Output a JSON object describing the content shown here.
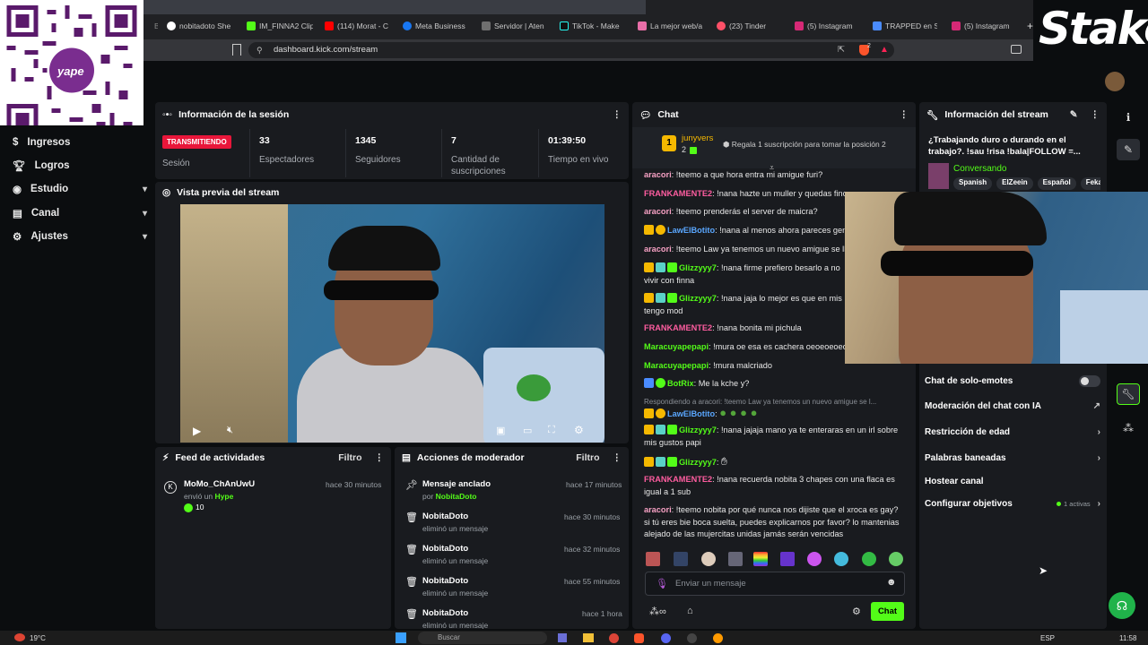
{
  "browser": {
    "tabs": [
      {
        "label": "nobitadoto She"
      },
      {
        "label": "IM_FINNA2 Clip"
      },
      {
        "label": "(114) Morat - C"
      },
      {
        "label": "Meta Business"
      },
      {
        "label": "Servidor | Aten"
      },
      {
        "label": "TikTok - Make"
      },
      {
        "label": "La mejor web/a"
      },
      {
        "label": "(23) Tinder"
      },
      {
        "label": "(5) Instagram"
      },
      {
        "label": "TRAPPED en St"
      },
      {
        "label": "(5) Instagram"
      }
    ],
    "url": "dashboard.kick.com/stream",
    "brave_count": "2"
  },
  "overlay": {
    "qr_brand": "yape",
    "stake_logo": "Stake"
  },
  "sidebar": {
    "items": [
      {
        "label": "Ingresos"
      },
      {
        "label": "Logros"
      },
      {
        "label": "Estudio",
        "chevron": "▾"
      },
      {
        "label": "Canal",
        "chevron": "▾"
      },
      {
        "label": "Ajustes",
        "chevron": "▾"
      }
    ]
  },
  "session": {
    "title": "Información de la sesión",
    "status": "TRANSMITIENDO",
    "session_label": "Sesión",
    "stats": [
      {
        "value": "33",
        "label": "Espectadores"
      },
      {
        "value": "1345",
        "label": "Seguidores"
      },
      {
        "value": "7",
        "label": "Cantidad de suscripciones"
      },
      {
        "value": "01:39:50",
        "label": "Tiempo en vivo"
      }
    ]
  },
  "preview": {
    "title": "Vista previa del stream"
  },
  "feed": {
    "title": "Feed de actividades",
    "filter": "Filtro",
    "items": [
      {
        "user": "MoMo_ChAnUwU",
        "action": "envió un",
        "item": "Hype",
        "time": "hace 30 minutos",
        "amount": "10"
      }
    ]
  },
  "modactions": {
    "title": "Acciones de moderador",
    "filter": "Filtro",
    "items": [
      {
        "title": "Mensaje anclado",
        "by": "por",
        "user": "NobitaDoto",
        "time": "hace 17 minutos"
      },
      {
        "title": "NobitaDoto",
        "sub": "eliminó un mensaje",
        "time": "hace 30 minutos"
      },
      {
        "title": "NobitaDoto",
        "sub": "eliminó un mensaje",
        "time": "hace 32 minutos"
      },
      {
        "title": "NobitaDoto",
        "sub": "eliminó un mensaje",
        "time": "hace 55 minutos"
      },
      {
        "title": "NobitaDoto",
        "sub": "eliminó un mensaje",
        "time": "hace 1 hora"
      }
    ]
  },
  "chat": {
    "title": "Chat",
    "top_user": "junyvers",
    "top_count": "2",
    "top_rank": "1",
    "gift_prompt": "Regala 1 suscripción para tomar la posición 2",
    "messages": [
      {
        "user": "aracori",
        "color": "#f7a1c4",
        "text": ": !teemo a que hora entra mi amigue furi?"
      },
      {
        "user": "FRANKAMENTE2",
        "color": "#ff5da0",
        "text": ": !nana hazte un muller y quedas fino"
      },
      {
        "user": "aracori",
        "color": "#f7a1c4",
        "text": ": !teemo prenderás el server de maicra?"
      },
      {
        "user": "LawElBotito",
        "color": "#5aa7ff",
        "text": ": !nana al menos ahora pareces gente"
      },
      {
        "user": "aracori",
        "color": "#f7a1c4",
        "text": ": !teemo Law ya tenemos un nuevo amigue se lla"
      },
      {
        "user": "Glizzyyy7",
        "color": "#53fc18",
        "text": ": !nana firme prefiero besarlo a no",
        "text2": "vivir con finna"
      },
      {
        "user": "Glizzyyy7",
        "color": "#53fc18",
        "text": ": !nana jaja lo mejor es que en mis",
        "text2": "tengo mod"
      },
      {
        "user": "FRANKAMENTE2",
        "color": "#ff5da0",
        "text": ": !nana bonita mi pichula"
      },
      {
        "user": "Maracuyapepapi",
        "color": "#53fc18",
        "text": ": !mura oe esa es cachera oeoeoeoeo"
      },
      {
        "user": "Maracuyapepapi",
        "color": "#53fc18",
        "text": ": !mura malcriado"
      },
      {
        "user": "BotRix",
        "color": "#53fc18",
        "text": ": Me la kche y?"
      },
      {
        "reply": "Respondiendo a aracori: !teemo Law ya tenemos un nuevo amigue se l...",
        "user": "LawElBotito",
        "color": "#5aa7ff",
        "text": ":"
      },
      {
        "user": "Glizzyyy7",
        "color": "#53fc18",
        "text": ": !nana jajaja mano ya te enteraras en un irl sobre",
        "text2": "mis gustos papi"
      },
      {
        "user": "Glizzyyy7",
        "color": "#53fc18",
        "text": ":"
      },
      {
        "user": "FRANKAMENTE2",
        "color": "#ff5da0",
        "text": ": !nana recuerda nobita 3 chapes con una flaca es",
        "text2": "igual a 1 sub"
      },
      {
        "user": "aracori",
        "color": "#f7a1c4",
        "text": ": !teemo nobita por qué nunca nos dijiste que el xroca es gay?",
        "text2": "si tú eres bie boca suelta, puedes explicarnos por favor? lo mantenias",
        "text3": "alejado de las mujercitas unidas jamás serán vencidas"
      }
    ],
    "input_placeholder": "Enviar un mensaje",
    "send_label": "Chat"
  },
  "stream_info": {
    "title": "Información del stream",
    "stream_title": "¿Trabajando duro o durando en el trabajo?. !sau !risa !bala|FOLLOW =...",
    "category": "Conversando",
    "tags": [
      "Spanish",
      "ElZeein",
      "Español",
      "Feka"
    ],
    "settings": [
      {
        "label": "Chat de solo-emotes",
        "type": "toggle",
        "on": false
      },
      {
        "label": "Moderación del chat con IA",
        "type": "external"
      },
      {
        "label": "Restricción de edad",
        "type": "chevron"
      },
      {
        "label": "Palabras baneadas",
        "type": "chevron"
      },
      {
        "label": "Hostear canal",
        "type": "none"
      },
      {
        "label": "Configurar objetivos",
        "type": "chevron",
        "note": "1 activas"
      }
    ]
  },
  "taskbar": {
    "weather": "19°C",
    "search": "Buscar",
    "lang": "ESP",
    "time": "11:58"
  },
  "colors": {
    "kick_green": "#53fc18",
    "live_red": "#e8163a",
    "panel": "#191b1f"
  }
}
